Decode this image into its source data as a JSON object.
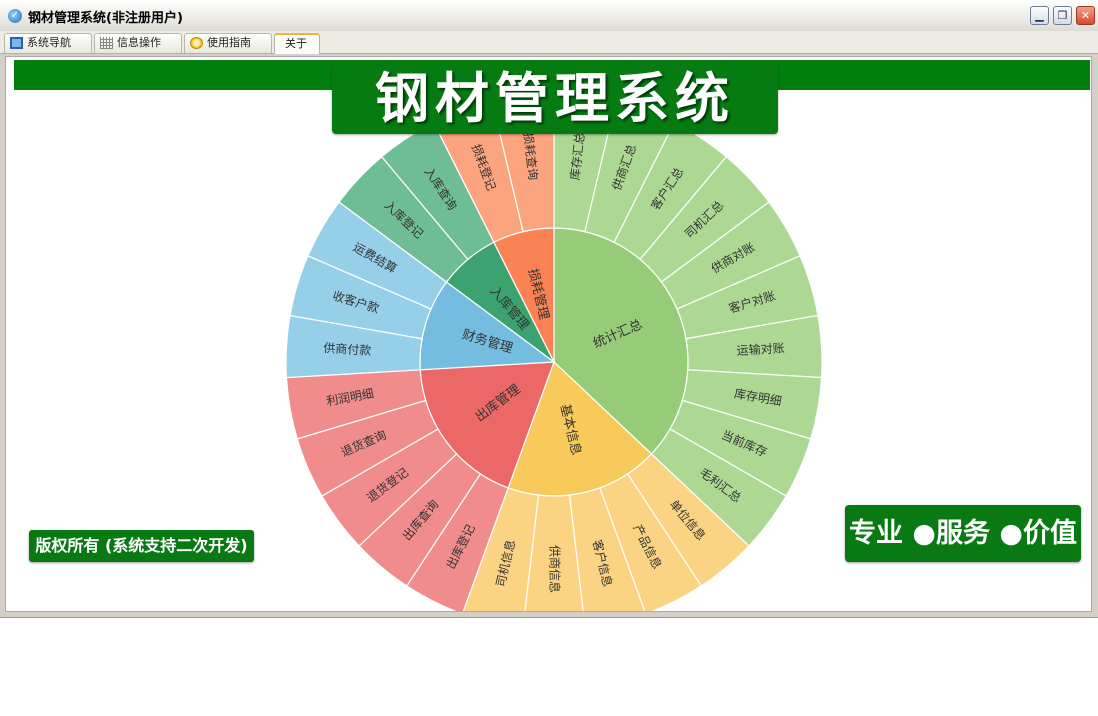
{
  "window": {
    "title": "钢材管理系统(非注册用户)",
    "controls": {
      "minimize": "▁",
      "maximize": "❐",
      "close": "✕"
    }
  },
  "tabs": [
    {
      "label": "系统导航",
      "icon": "monitor-icon"
    },
    {
      "label": "信息操作",
      "icon": "grid-icon"
    },
    {
      "label": "使用指南",
      "icon": "bulb-icon"
    },
    {
      "label": "关于",
      "active": true
    }
  ],
  "banner": {
    "title": "钢材管理系统"
  },
  "footer": {
    "copyright": "版权所有 (系统支持二次开发)",
    "slogan": "专业 ●服务 ●价值"
  },
  "colors": {
    "brand_green": "#057b11"
  },
  "chart_data": {
    "type": "sunburst",
    "start_angle_deg": 0,
    "groups": [
      {
        "name": "统计汇总",
        "inner": "#96cc78",
        "outer": "#acd894",
        "children": [
          "库存汇总",
          "供商汇总",
          "客户汇总",
          "司机汇总",
          "供商对账",
          "客户对账",
          "运输对账",
          "库存明细",
          "当前库存",
          "毛利汇总"
        ]
      },
      {
        "name": "基本信息",
        "inner": "#f8c95b",
        "outer": "#fad483",
        "children": [
          "单位信息",
          "产品信息",
          "客户信息",
          "供商信息",
          "司机信息"
        ]
      },
      {
        "name": "出库管理",
        "inner": "#ec6867",
        "outer": "#f08c8b",
        "children": [
          "出库登记",
          "出库查询",
          "退货登记",
          "退货查询",
          "利润明细"
        ]
      },
      {
        "name": "财务管理",
        "inner": "#74bde0",
        "outer": "#96cfe8",
        "children": [
          "供商付款",
          "收客户款",
          "运费结算"
        ]
      },
      {
        "name": "入库管理",
        "inner": "#3ca370",
        "outer": "#6ebd95",
        "children": [
          "入库登记",
          "入库查询"
        ]
      },
      {
        "name": "损耗管理",
        "inner": "#fb8353",
        "outer": "#fca47e",
        "children": [
          "损耗登记",
          "损耗查询"
        ]
      }
    ]
  }
}
